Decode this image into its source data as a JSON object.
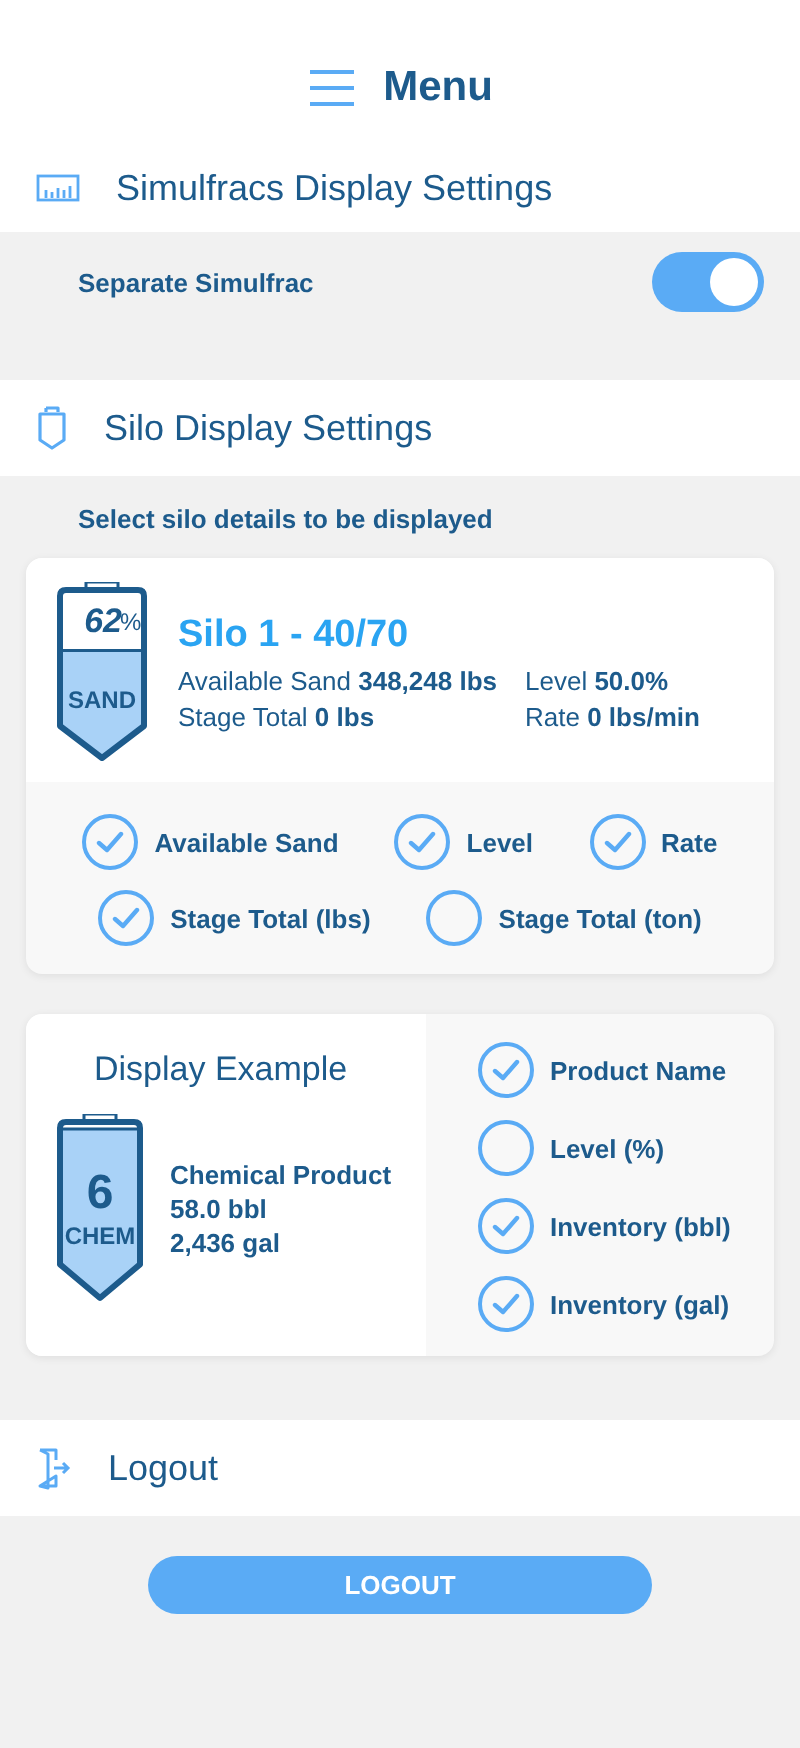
{
  "header": {
    "title": "Menu"
  },
  "simulfracs": {
    "title": "Simulfracs Display Settings",
    "toggle": {
      "label": "Separate Simulfrac",
      "on": true
    }
  },
  "silo_settings": {
    "title": "Silo Display Settings",
    "subtitle": "Select silo details to be displayed",
    "silo_card": {
      "tank": {
        "percent": "62",
        "unit": "%",
        "product": "SAND",
        "level": 0.62
      },
      "name": "Silo 1 - 40/70",
      "stats": [
        {
          "label": "Available Sand",
          "value": "348,248 lbs"
        },
        {
          "label": "Level",
          "value": "50.0%"
        },
        {
          "label": "Stage Total",
          "value": "0 lbs"
        },
        {
          "label": "Rate",
          "value": "0 lbs/min"
        }
      ],
      "options": [
        {
          "label": "Available Sand",
          "checked": true
        },
        {
          "label": "Level",
          "checked": true
        },
        {
          "label": "Rate",
          "checked": true
        },
        {
          "label": "Stage Total (lbs)",
          "checked": true
        },
        {
          "label": "Stage Total (ton)",
          "checked": false
        }
      ]
    },
    "example_card": {
      "title": "Display Example",
      "tank": {
        "number": "6",
        "product": "CHEM",
        "level": 0.92
      },
      "lines": [
        "Chemical Product",
        "58.0 bbl",
        "2,436 gal"
      ],
      "options": [
        {
          "label": "Product Name",
          "checked": true
        },
        {
          "label": "Level (%)",
          "checked": false
        },
        {
          "label": "Inventory (bbl)",
          "checked": true
        },
        {
          "label": "Inventory (gal)",
          "checked": true
        }
      ]
    }
  },
  "logout": {
    "title": "Logout",
    "button": "LOGOUT"
  }
}
